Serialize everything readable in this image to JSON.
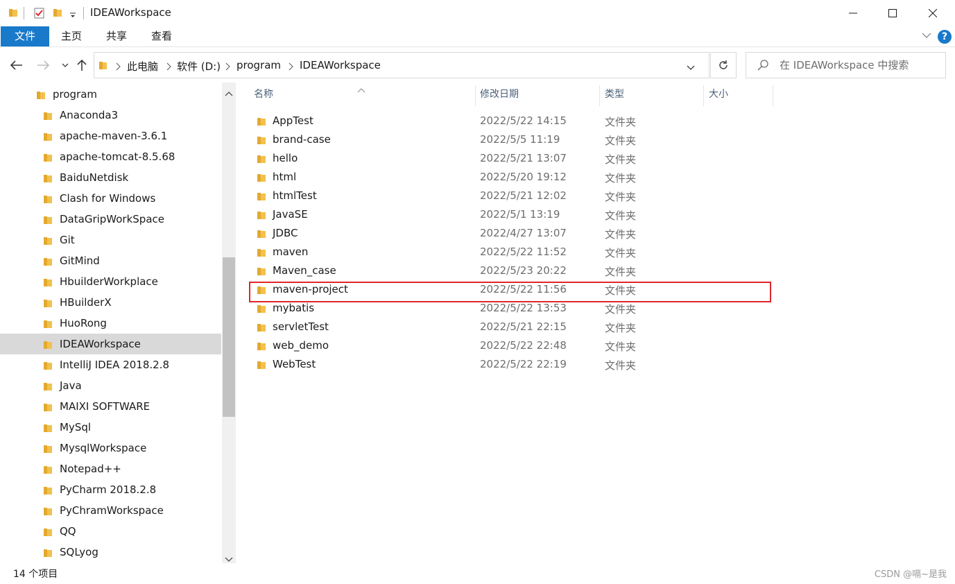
{
  "window": {
    "title": "IDEAWorkspace",
    "quick_access": [
      "folder-icon",
      "properties-icon",
      "new-folder-icon"
    ],
    "controls": [
      "minimize-icon",
      "maximize-icon",
      "close-icon"
    ]
  },
  "ribbon": {
    "tabs": [
      {
        "label": "文件",
        "active": true
      },
      {
        "label": "主页"
      },
      {
        "label": "共享"
      },
      {
        "label": "查看"
      }
    ],
    "help_label": "?"
  },
  "navigation": {
    "breadcrumb": [
      "此电脑",
      "软件 (D:)",
      "program",
      "IDEAWorkspace"
    ],
    "search_placeholder": "在 IDEAWorkspace 中搜索"
  },
  "tree": {
    "items": [
      {
        "label": "program",
        "level": 0
      },
      {
        "label": "Anaconda3",
        "level": 1
      },
      {
        "label": "apache-maven-3.6.1",
        "level": 1
      },
      {
        "label": "apache-tomcat-8.5.68",
        "level": 1
      },
      {
        "label": "BaiduNetdisk",
        "level": 1
      },
      {
        "label": "Clash for Windows",
        "level": 1
      },
      {
        "label": "DataGripWorkSpace",
        "level": 1
      },
      {
        "label": "Git",
        "level": 1
      },
      {
        "label": "GitMind",
        "level": 1
      },
      {
        "label": "HbuilderWorkplace",
        "level": 1
      },
      {
        "label": "HBuilderX",
        "level": 1
      },
      {
        "label": "HuoRong",
        "level": 1
      },
      {
        "label": "IDEAWorkspace",
        "level": 1,
        "selected": true
      },
      {
        "label": "IntelliJ IDEA 2018.2.8",
        "level": 1
      },
      {
        "label": "Java",
        "level": 1
      },
      {
        "label": "MAIXI SOFTWARE",
        "level": 1
      },
      {
        "label": "MySql",
        "level": 1
      },
      {
        "label": "MysqlWorkspace",
        "level": 1
      },
      {
        "label": "Notepad++",
        "level": 1
      },
      {
        "label": "PyCharm 2018.2.8",
        "level": 1
      },
      {
        "label": "PyChramWorkspace",
        "level": 1
      },
      {
        "label": "QQ",
        "level": 1
      },
      {
        "label": "SQLyog",
        "level": 1
      }
    ]
  },
  "file_list": {
    "columns": [
      "名称",
      "修改日期",
      "类型",
      "大小"
    ],
    "rows": [
      {
        "name": "AppTest",
        "date": "2022/5/22 14:15",
        "type": "文件夹"
      },
      {
        "name": "brand-case",
        "date": "2022/5/5 11:19",
        "type": "文件夹"
      },
      {
        "name": "hello",
        "date": "2022/5/21 13:07",
        "type": "文件夹"
      },
      {
        "name": "html",
        "date": "2022/5/20 19:12",
        "type": "文件夹"
      },
      {
        "name": "htmlTest",
        "date": "2022/5/21 12:02",
        "type": "文件夹"
      },
      {
        "name": "JavaSE",
        "date": "2022/5/1 13:19",
        "type": "文件夹"
      },
      {
        "name": "JDBC",
        "date": "2022/4/27 13:07",
        "type": "文件夹"
      },
      {
        "name": "maven",
        "date": "2022/5/22 11:52",
        "type": "文件夹"
      },
      {
        "name": "Maven_case",
        "date": "2022/5/23 20:22",
        "type": "文件夹"
      },
      {
        "name": "maven-project",
        "date": "2022/5/22 11:56",
        "type": "文件夹",
        "highlighted": true
      },
      {
        "name": "mybatis",
        "date": "2022/5/22 13:53",
        "type": "文件夹"
      },
      {
        "name": "servletTest",
        "date": "2022/5/21 22:15",
        "type": "文件夹"
      },
      {
        "name": "web_demo",
        "date": "2022/5/22 22:48",
        "type": "文件夹"
      },
      {
        "name": "WebTest",
        "date": "2022/5/22 22:19",
        "type": "文件夹"
      }
    ]
  },
  "status": {
    "item_count": "14 个项目",
    "watermark": "CSDN @嗝~是我"
  },
  "colors": {
    "accent": "#1979ca",
    "folder": "#f2c14e",
    "highlight_border": "#e0262b",
    "selected_bg": "#d9d9d9"
  }
}
